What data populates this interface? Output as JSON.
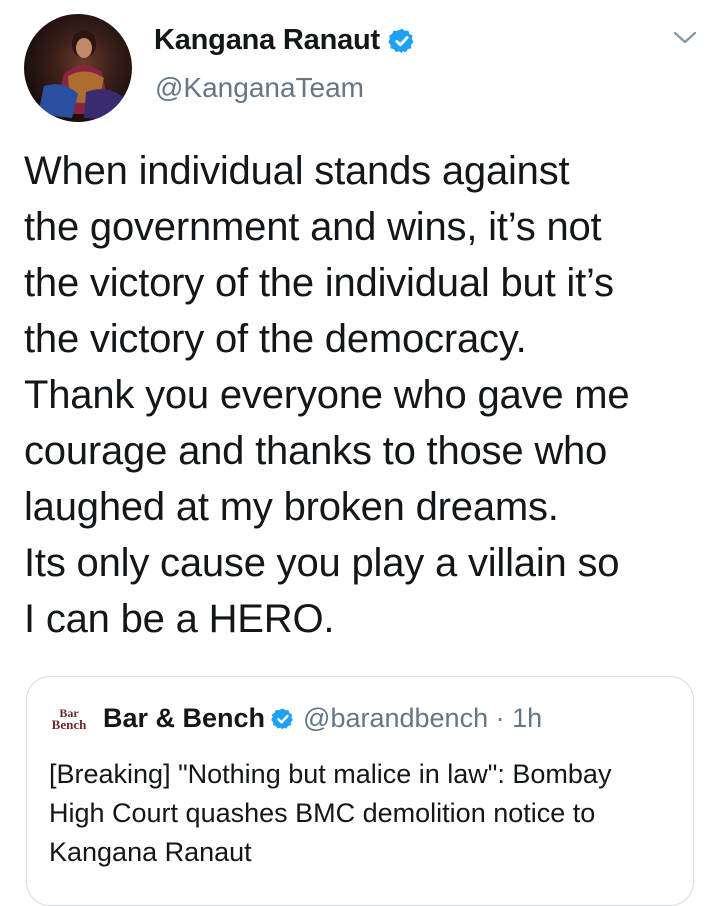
{
  "tweet": {
    "author_name": "Kangana Ranaut",
    "author_handle": "@KanganaTeam",
    "lines": [
      "When individual stands against",
      "the government and wins, it’s not",
      "the victory of the individual but it’s",
      "the victory of the democracy.",
      "Thank you everyone who gave me",
      "courage and thanks to those who",
      "laughed at my broken dreams.",
      "Its only cause you play a villain so",
      "I can be a HERO."
    ]
  },
  "quoted": {
    "logo_line1": "Bar",
    "logo_line2": "Bench",
    "author_name": "Bar & Bench",
    "author_handle": "@barandbench",
    "separator": " · ",
    "time": "1h",
    "lines": [
      "[Breaking] \"Nothing but malice in law\": Bombay",
      "High Court quashes BMC demolition notice to",
      "Kangana Ranaut"
    ]
  },
  "colors": {
    "verified_blue": "#1da1f2",
    "secondary_text": "#657786",
    "border": "#d6dde3"
  },
  "icons": {
    "verified": "verified-badge-icon",
    "more": "chevron-down-icon"
  }
}
